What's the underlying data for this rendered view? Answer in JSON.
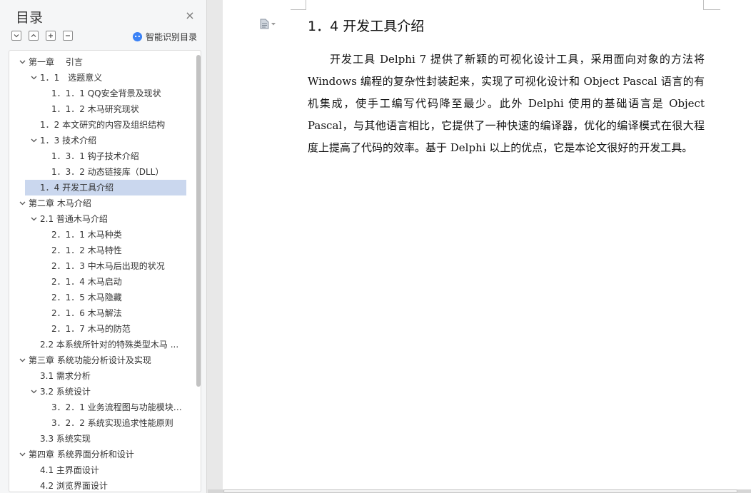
{
  "sidebar": {
    "title": "目录",
    "smart_label": "智能识别目录",
    "toc": [
      {
        "label": "第一章　 引言",
        "level": 1,
        "expanded": true
      },
      {
        "label": "1．1　选题意义",
        "level": 2,
        "expanded": true
      },
      {
        "label": "1．1．1 QQ安全背景及现状",
        "level": 3
      },
      {
        "label": "1．1．2 木马研究现状",
        "level": 3
      },
      {
        "label": "1．2 本文研究的内容及组织结构",
        "level": 2
      },
      {
        "label": "1．3 技术介绍",
        "level": 2,
        "expanded": true
      },
      {
        "label": "1．3．1 钩子技术介绍",
        "level": 3
      },
      {
        "label": "1．3．2 动态链接库（DLL）",
        "level": 3
      },
      {
        "label": "1．4 开发工具介绍",
        "level": 2,
        "active": true
      },
      {
        "label": "第二章  木马介绍",
        "level": 1,
        "expanded": true
      },
      {
        "label": "2.1  普通木马介绍",
        "level": 2,
        "expanded": true
      },
      {
        "label": "2．1．1 木马种类",
        "level": 3
      },
      {
        "label": "2．1．2 木马特性",
        "level": 3
      },
      {
        "label": "2．1．3 中木马后出现的状况",
        "level": 3
      },
      {
        "label": "2．1．4 木马启动",
        "level": 3
      },
      {
        "label": "2．1．5 木马隐藏",
        "level": 3
      },
      {
        "label": "2．1．6 木马解法",
        "level": 3
      },
      {
        "label": "2．1．7 木马的防范",
        "level": 3
      },
      {
        "label": "2.2 本系统所针对的特殊类型木马 ...",
        "level": 2
      },
      {
        "label": "第三章  系统功能分析设计及实现",
        "level": 1,
        "expanded": true
      },
      {
        "label": "3.1 需求分析",
        "level": 2
      },
      {
        "label": "3.2  系统设计",
        "level": 2,
        "expanded": true
      },
      {
        "label": "3．2．1 业务流程图与功能模块 ...",
        "level": 3
      },
      {
        "label": "3．2．2  系统实现追求性能原则",
        "level": 3
      },
      {
        "label": "3.3 系统实现",
        "level": 2
      },
      {
        "label": "第四章  系统界面分析和设计",
        "level": 1,
        "expanded": true
      },
      {
        "label": "4.1 主界面设计",
        "level": 2
      },
      {
        "label": "4.2 浏览界面设计",
        "level": 2
      }
    ]
  },
  "document": {
    "heading": "1．4 开发工具介绍",
    "paragraph": "开发工具 Delphi 7 提供了新颖的可视化设计工具，采用面向对象的方法将 Windows 编程的复杂性封装起来，实现了可视化设计和 Object Pascal 语言的有机集成，使手工编写代码降至最少。此外 Delphi 使用的基础语言是 Object Pascal，与其他语言相比，它提供了一种快速的编译器，优化的编译模式在很大程度上提高了代码的效率。基于 Delphi 以上的优点，它是本论文很好的开发工具。"
  },
  "colors": {
    "active_bg": "#cad7ee",
    "smart_icon": "#3b82f6"
  }
}
